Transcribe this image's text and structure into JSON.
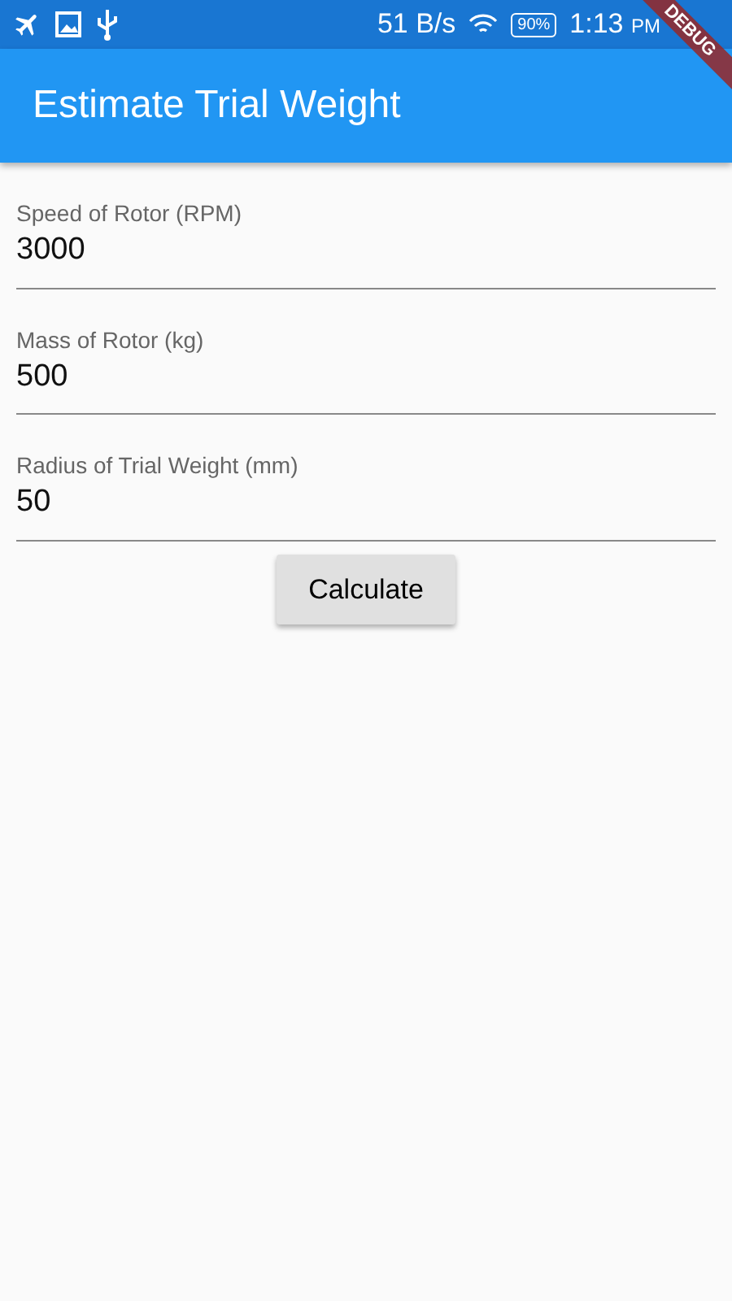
{
  "status_bar": {
    "net_speed": "51 B/s",
    "battery": "90%",
    "time": "1:13",
    "ampm": "PM"
  },
  "debug_banner": "DEBUG",
  "app_bar": {
    "title": "Estimate Trial Weight"
  },
  "fields": [
    {
      "label": "Speed of Rotor (RPM)",
      "value": "3000"
    },
    {
      "label": "Mass of Rotor (kg)",
      "value": "500"
    },
    {
      "label": "Radius of Trial Weight (mm)",
      "value": "50"
    }
  ],
  "button": "Calculate"
}
